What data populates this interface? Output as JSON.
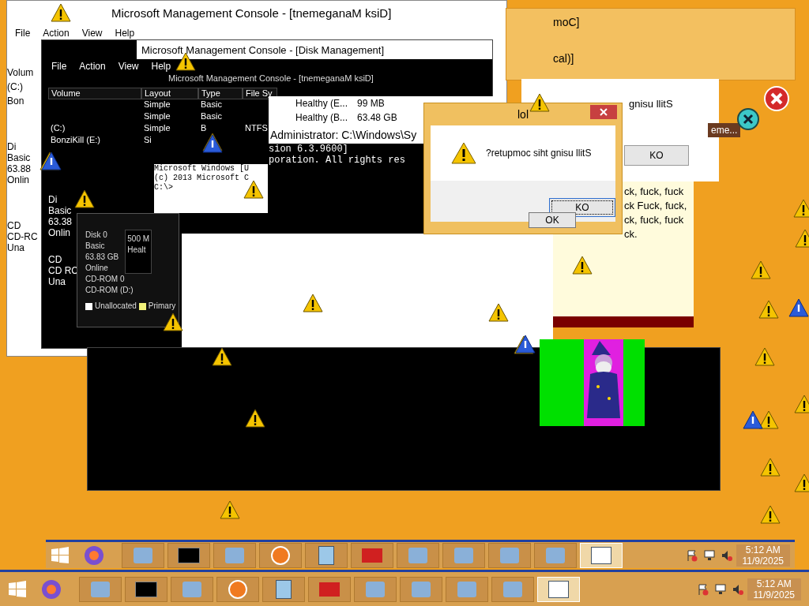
{
  "back_console": {
    "title": "Microsoft Management Console - [tnemeganaM ksiD]",
    "menu": [
      "File",
      "Action",
      "View",
      "Help"
    ],
    "volume_header": "Volum",
    "volumes": [
      "(C:)",
      "Bon"
    ],
    "disk_lines": [
      "Di",
      "Basic",
      "63.88",
      "Onlin"
    ],
    "cd_lines": [
      "CD",
      "CD-RC"
    ],
    "legend": "Una"
  },
  "disk_console": {
    "title": "Microsoft Management Console - [Disk Management]",
    "menu": [
      "File",
      "Action",
      "View",
      "Help"
    ],
    "subtitle": "Microsoft Management Console - [tnemeganaM ksiD]",
    "columns": [
      "Volume",
      "Layout",
      "Type",
      "File Sy"
    ],
    "rows": [
      {
        "volume": null,
        "layout": "Simple",
        "type": "Basic",
        "fs": null
      },
      {
        "volume": null,
        "layout": "Simple",
        "type": "Basic",
        "fs": null
      },
      {
        "volume": "(C:)",
        "layout": "Simple",
        "type": "B",
        "fs": "NTFS"
      },
      {
        "volume": "BonziKill (E:)",
        "layout": "Si",
        "type": null,
        "fs": null
      }
    ],
    "disk_lines": [
      "Di",
      "Basic",
      "63.38",
      "Onlin"
    ],
    "cd_lines": [
      "CD",
      "CD RC"
    ],
    "legend": "Una"
  },
  "disk_panel": {
    "disk_lines": [
      "Disk 0",
      "Basic",
      "63.83 GB",
      "Online"
    ],
    "partition_lines": [
      "500 M",
      "Healt"
    ],
    "cd_lines": [
      "CD-ROM 0",
      "CD-ROM (D:)"
    ],
    "legend": [
      {
        "label": "Unallocated",
        "color": "#ffffff"
      },
      {
        "label": "Primary",
        "color": "#f2f27a"
      }
    ]
  },
  "partitions": [
    {
      "status": "Healthy (E...",
      "size": "99 MB"
    },
    {
      "status": "Healthy (B...",
      "size": "63.48 GB"
    }
  ],
  "cmd": {
    "title": "Administrator: C:\\Windows\\Sy",
    "lines": [
      "sion 6.3.9600]",
      "poration. All rights res"
    ]
  },
  "small_cmd": {
    "lines": [
      "Microsoft Windows [U",
      "(c) 2013 Microsoft C",
      "C:\\>"
    ]
  },
  "back_window": {
    "title_fragments": [
      "moC]",
      "cal)]"
    ],
    "message": "gnisu llitS",
    "button": "KO",
    "tab": "eme..."
  },
  "speech_bubble": {
    "lines": [
      "ck, fuck, fuck",
      "ck Fuck, fuck,",
      "ck, fuck, fuck",
      "ck."
    ]
  },
  "dialog": {
    "title": "lol",
    "message": "?retupmoc siht gnisu llitS",
    "buttons": [
      {
        "label": "KO",
        "focused": true
      },
      {
        "label": "OK",
        "focused": false
      }
    ]
  },
  "taskbars": [
    {
      "time": "5:12 AM",
      "date": "11/9/2025"
    },
    {
      "time": "5:12 AM",
      "date": "11/9/2025"
    }
  ]
}
